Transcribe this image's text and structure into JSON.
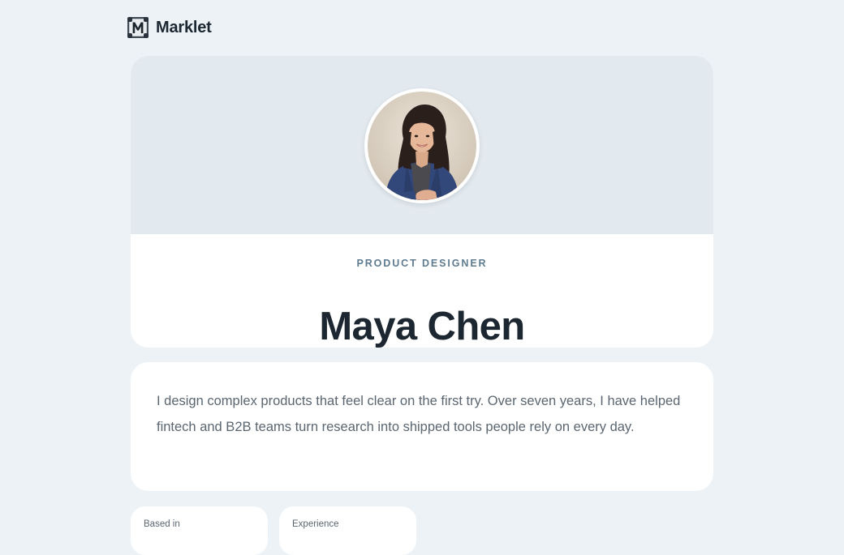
{
  "brand": {
    "name": "Marklet",
    "logo_icon": "m-badge-icon"
  },
  "profile": {
    "role": "PRODUCT DESIGNER",
    "name": "Maya Chen",
    "photo": "portrait-photo"
  },
  "bio": {
    "text": "I design complex products that feel clear on the first try. Over seven years, I have helped fintech and B2B teams turn research into shipped tools people rely on every day."
  },
  "facts": [
    {
      "label": "Based in"
    },
    {
      "label": "Experience"
    }
  ],
  "colors": {
    "page_background": "#edf2f6",
    "banner": "#e2e9ef",
    "card": "#ffffff",
    "heading": "#1c2731",
    "role_accent": "#5e7b90",
    "body_text": "#5b6670"
  }
}
